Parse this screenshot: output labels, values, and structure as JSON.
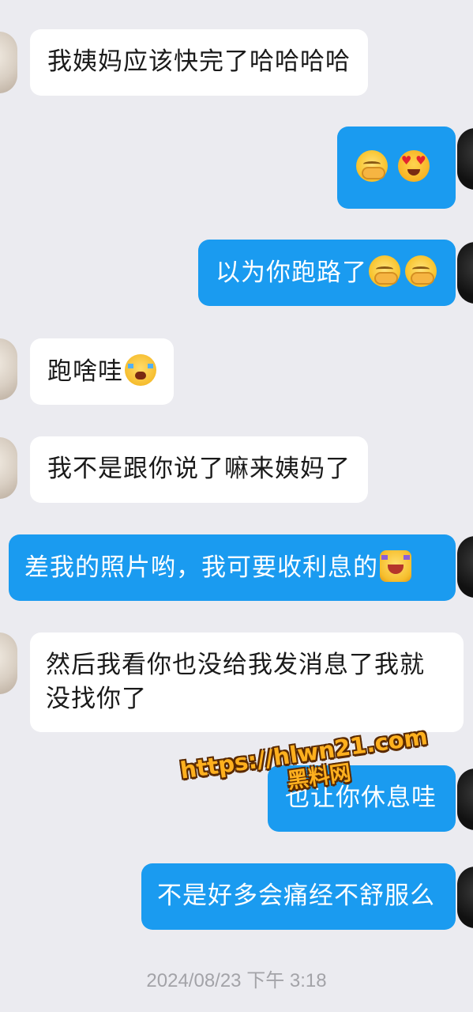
{
  "messages": [
    {
      "id": 1,
      "side": "in",
      "text": "我姨妈应该快完了哈哈哈哈",
      "emojis": []
    },
    {
      "id": 2,
      "side": "out",
      "text": "",
      "emojis": [
        "shy-face",
        "heart-eyes-face"
      ]
    },
    {
      "id": 3,
      "side": "out",
      "text": "以为你跑路了",
      "emojis": [
        "shy-face",
        "shy-face"
      ]
    },
    {
      "id": 4,
      "side": "in",
      "text": "跑啥哇",
      "emojis": [
        "crying-face"
      ]
    },
    {
      "id": 5,
      "side": "in",
      "text": "我不是跟你说了嘛来姨妈了",
      "emojis": []
    },
    {
      "id": 6,
      "side": "out",
      "text": "差我的照片哟，我可要收利息的",
      "emojis": [
        "laughing-face"
      ]
    },
    {
      "id": 7,
      "side": "in",
      "line1": "然后我看你也没给我发消息了我就",
      "line2": "没找你了",
      "emojis": []
    },
    {
      "id": 8,
      "side": "out",
      "text": "也让你休息哇",
      "emojis": []
    },
    {
      "id": 9,
      "side": "out",
      "text": "不是好多会痛经不舒服么",
      "emojis": []
    }
  ],
  "timestamp": "2024/08/23 下午 3:18",
  "watermark": {
    "line1": "https://hlwn21.com",
    "line2": "黑料网"
  },
  "colors": {
    "background": "#ebebf0",
    "incoming_bubble": "#ffffff",
    "outgoing_bubble": "#1a9bf0",
    "watermark": "#ffb01e"
  }
}
